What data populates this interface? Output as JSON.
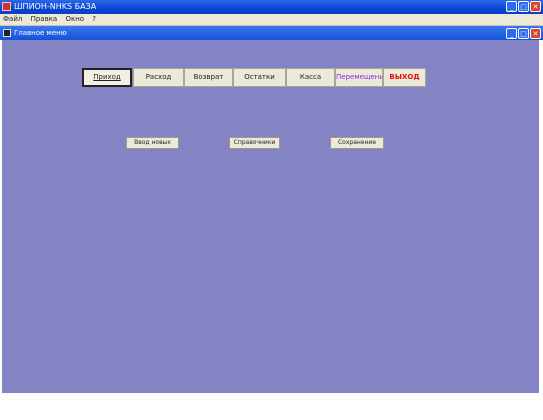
{
  "app": {
    "title": "ШПИОН-NHKS БАЗА",
    "window_buttons": [
      "_",
      "□",
      "✕"
    ]
  },
  "menu": [
    "Файл",
    "Правка",
    "Окно",
    "?"
  ],
  "mdi": {
    "title": "Главное меню",
    "window_buttons": [
      "_",
      "□",
      "✕"
    ]
  },
  "tabs": [
    {
      "label": "Приход"
    },
    {
      "label": "Расход"
    },
    {
      "label": "Возврат"
    },
    {
      "label": "Остатки"
    },
    {
      "label": "Касса"
    },
    {
      "label": "Перемещение"
    },
    {
      "label": "ВЫХОД"
    }
  ],
  "actions": [
    {
      "label": "Ввод новых"
    },
    {
      "label": "Справочники"
    },
    {
      "label": "Сохранение"
    }
  ],
  "colors": {
    "workspace": "#8484c4",
    "titlebar": "#0a46d4",
    "exit_label": "#e01010",
    "transfer_label": "#8a2be2"
  }
}
